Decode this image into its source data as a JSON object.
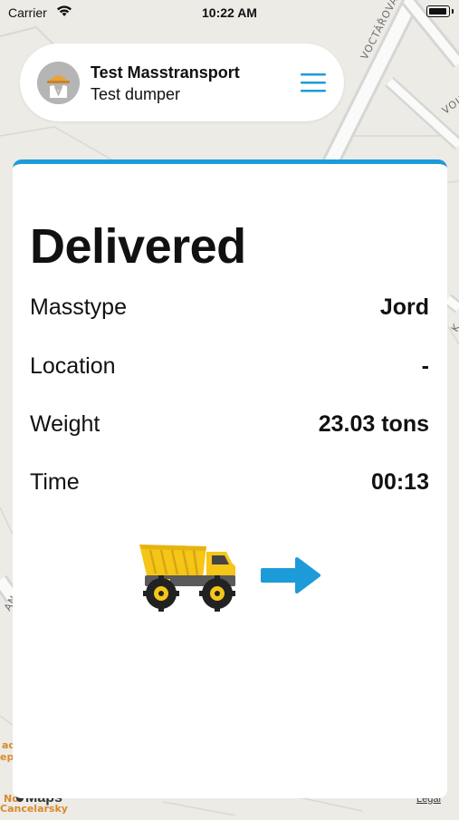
{
  "status_bar": {
    "carrier": "Carrier",
    "time": "10:22 AM"
  },
  "map": {
    "street_labels": [
      "VOCTÁŘOVA",
      "VOJEN",
      "K",
      "AN"
    ],
    "poi_labels": [
      "ad",
      "eplu",
      "No",
      "Cancelarsky"
    ],
    "attribution": "Maps",
    "legal": "Legal"
  },
  "header": {
    "company": "Test Masstransport",
    "vehicle": "Test dumper"
  },
  "card": {
    "status": "Delivered",
    "rows": [
      {
        "label": "Masstype",
        "value": "Jord"
      },
      {
        "label": "Location",
        "value": "-"
      },
      {
        "label": "Weight",
        "value": "23.03 tons"
      },
      {
        "label": "Time",
        "value": "00:13"
      }
    ]
  },
  "colors": {
    "accent": "#1d9bd8",
    "truck": "#f5c518",
    "arrow": "#1d9bd8"
  },
  "icons": {
    "menu": "hamburger-icon",
    "avatar": "helmet-avatar-icon",
    "truck": "dump-truck-icon",
    "arrow": "arrow-right-icon"
  }
}
